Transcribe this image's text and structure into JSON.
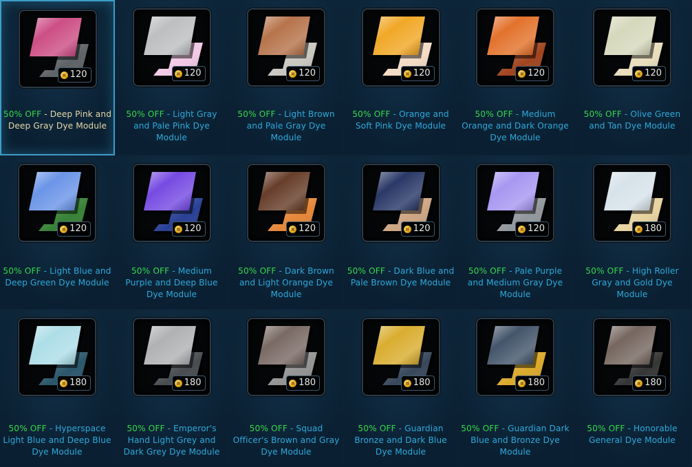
{
  "discount_label": "50% OFF",
  "separator": " - ",
  "currency_icon": "cartel-coin-icon",
  "items": [
    {
      "name": "Deep Pink and Deep Gray Dye Module",
      "price": "120",
      "primary": "#c83f7a",
      "secondary": "#555a5e",
      "selected": true
    },
    {
      "name": "Light Gray and Pale Pink Dye Module",
      "price": "120",
      "primary": "#b7b9bb",
      "secondary": "#f1c6e4"
    },
    {
      "name": "Light Brown and Pale Gray Dye Module",
      "price": "120",
      "primary": "#b0683c",
      "secondary": "#c7c3bd"
    },
    {
      "name": "Orange and Soft Pink Dye Module",
      "price": "120",
      "primary": "#f0a014",
      "secondary": "#f2d9c2"
    },
    {
      "name": "Medium Orange and Dark Orange Dye Module",
      "price": "120",
      "primary": "#e0661a",
      "secondary": "#9c3a12"
    },
    {
      "name": "Olive Green and Tan Dye Module",
      "price": "120",
      "primary": "#d2d5b6",
      "secondary": "#e7dcb8"
    },
    {
      "name": "Light Blue and Deep Green Dye Module",
      "price": "120",
      "primary": "#5f8ce6",
      "secondary": "#2c7a2c"
    },
    {
      "name": "Medium Purple and Deep Blue Dye Module",
      "price": "120",
      "primary": "#6a3be0",
      "secondary": "#1c3590"
    },
    {
      "name": "Dark Brown and Light Orange Dye Module",
      "price": "120",
      "primary": "#5a2d18",
      "secondary": "#e4802e"
    },
    {
      "name": "Dark Blue and Pale Brown Dye Module",
      "price": "120",
      "primary": "#17275a",
      "secondary": "#caa07c"
    },
    {
      "name": "Pale Purple and Medium Gray Dye Module",
      "price": "120",
      "primary": "#a18ef0",
      "secondary": "#8c9297"
    },
    {
      "name": "High Roller Gray and Gold Dye Module",
      "price": "180",
      "primary": "#d3e0e8",
      "secondary": "#e6d09a"
    },
    {
      "name": "Hyperspace Light Blue and Deep Blue Dye Module",
      "price": "180",
      "primary": "#a6dbe6",
      "secondary": "#1f4d63"
    },
    {
      "name": "Emperor's Hand Light Grey and Dark Grey Dye Module",
      "price": "180",
      "primary": "#a9abad",
      "secondary": "#3e4246"
    },
    {
      "name": "Squad Officer's Brown and Gray Dye Module",
      "price": "180",
      "primary": "#6e5d57",
      "secondary": "#8e8e8e"
    },
    {
      "name": "Guardian Bronze and Dark Blue Dye Module",
      "price": "180",
      "primary": "#d6a61e",
      "secondary": "#2d3d52"
    },
    {
      "name": "Guardian Dark Blue and Bronze Dye Module",
      "price": "180",
      "primary": "#34475e",
      "secondary": "#d9a520"
    },
    {
      "name": "Honorable General Dye Module",
      "price": "180",
      "primary": "#6a5a52",
      "secondary": "#2a2a2a"
    }
  ]
}
